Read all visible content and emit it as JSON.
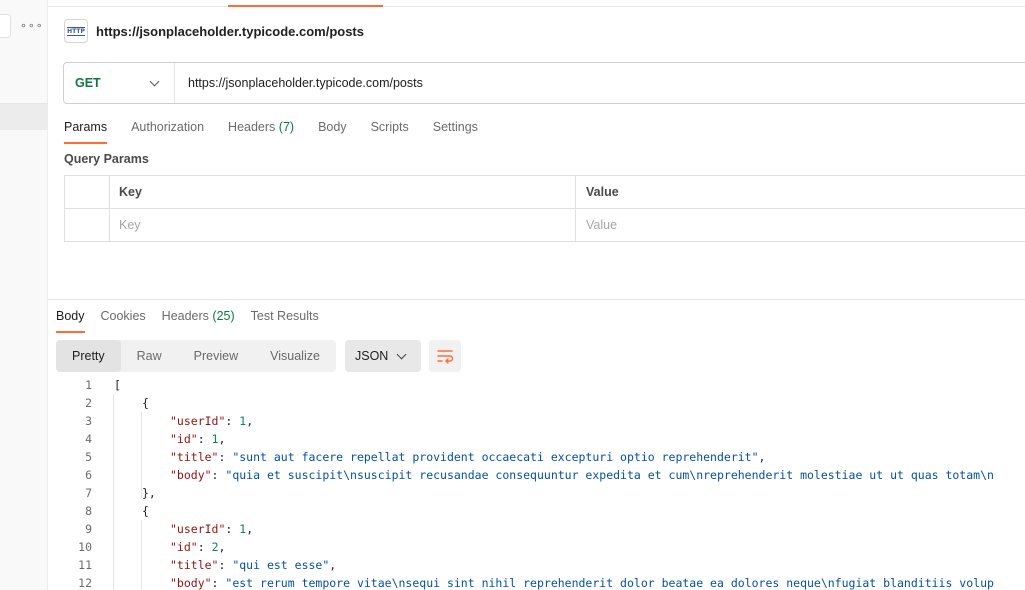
{
  "request": {
    "title": "https://jsonplaceholder.typicode.com/posts",
    "method": "GET",
    "url": "https://jsonplaceholder.typicode.com/posts",
    "icon": "http-icon"
  },
  "request_tabs": [
    {
      "label": "Params",
      "active": true
    },
    {
      "label": "Authorization"
    },
    {
      "label": "Headers",
      "count": "(7)"
    },
    {
      "label": "Body"
    },
    {
      "label": "Scripts"
    },
    {
      "label": "Settings"
    }
  ],
  "query_params": {
    "label": "Query Params",
    "col_key": "Key",
    "col_value": "Value",
    "key_placeholder": "Key",
    "value_placeholder": "Value"
  },
  "response_tabs": [
    {
      "label": "Body",
      "active": true
    },
    {
      "label": "Cookies"
    },
    {
      "label": "Headers",
      "count": "(25)"
    },
    {
      "label": "Test Results"
    }
  ],
  "view_modes": [
    "Pretty",
    "Raw",
    "Preview",
    "Visualize"
  ],
  "active_view_mode": "Pretty",
  "format": "JSON",
  "colors": {
    "accent": "#ff6c37",
    "method_get": "#0b7a3e",
    "json_key": "#9a1010",
    "json_string": "#0451a5",
    "json_number": "#098658"
  },
  "code_lines": [
    {
      "n": "1",
      "indent": 0,
      "parts": [
        {
          "t": "["
        }
      ]
    },
    {
      "n": "2",
      "indent": 1,
      "parts": [
        {
          "t": "{"
        }
      ]
    },
    {
      "n": "3",
      "indent": 2,
      "parts": [
        {
          "t": "\"userId\"",
          "c": "key"
        },
        {
          "t": ": "
        },
        {
          "t": "1",
          "c": "num"
        },
        {
          "t": ","
        }
      ]
    },
    {
      "n": "4",
      "indent": 2,
      "parts": [
        {
          "t": "\"id\"",
          "c": "key"
        },
        {
          "t": ": "
        },
        {
          "t": "1",
          "c": "num"
        },
        {
          "t": ","
        }
      ]
    },
    {
      "n": "5",
      "indent": 2,
      "parts": [
        {
          "t": "\"title\"",
          "c": "key"
        },
        {
          "t": ": "
        },
        {
          "t": "\"sunt aut facere repellat provident occaecati excepturi optio reprehenderit\"",
          "c": "str"
        },
        {
          "t": ","
        }
      ]
    },
    {
      "n": "6",
      "indent": 2,
      "parts": [
        {
          "t": "\"body\"",
          "c": "key"
        },
        {
          "t": ": "
        },
        {
          "t": "\"quia et suscipit\\nsuscipit recusandae consequuntur expedita et cum\\nreprehenderit molestiae ut ut quas totam\\n",
          "c": "str"
        }
      ]
    },
    {
      "n": "7",
      "indent": 1,
      "parts": [
        {
          "t": "},"
        }
      ]
    },
    {
      "n": "8",
      "indent": 1,
      "parts": [
        {
          "t": "{"
        }
      ]
    },
    {
      "n": "9",
      "indent": 2,
      "parts": [
        {
          "t": "\"userId\"",
          "c": "key"
        },
        {
          "t": ": "
        },
        {
          "t": "1",
          "c": "num"
        },
        {
          "t": ","
        }
      ]
    },
    {
      "n": "10",
      "indent": 2,
      "parts": [
        {
          "t": "\"id\"",
          "c": "key"
        },
        {
          "t": ": "
        },
        {
          "t": "2",
          "c": "num"
        },
        {
          "t": ","
        }
      ]
    },
    {
      "n": "11",
      "indent": 2,
      "parts": [
        {
          "t": "\"title\"",
          "c": "key"
        },
        {
          "t": ": "
        },
        {
          "t": "\"qui est esse\"",
          "c": "str"
        },
        {
          "t": ","
        }
      ]
    },
    {
      "n": "12",
      "indent": 2,
      "parts": [
        {
          "t": "\"body\"",
          "c": "key"
        },
        {
          "t": ": "
        },
        {
          "t": "\"est rerum tempore vitae\\nsequi sint nihil reprehenderit dolor beatae ea dolores neque\\nfugiat blanditiis volup",
          "c": "str"
        }
      ]
    }
  ]
}
